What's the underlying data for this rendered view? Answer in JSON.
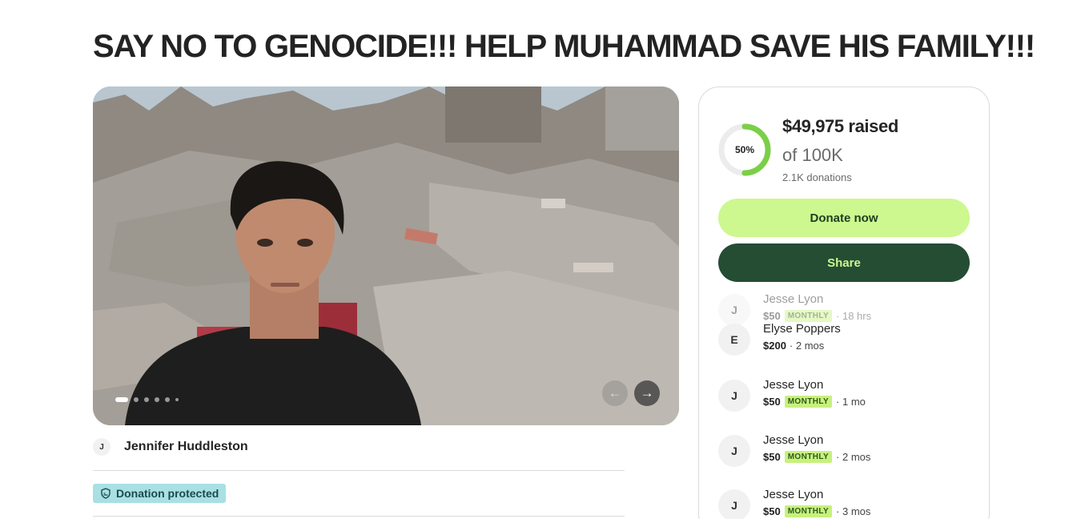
{
  "campaign": {
    "title": "SAY NO TO GENOCIDE!!! HELP MUHAMMAD SAVE HIS FAMILY!!!",
    "organizer_initial": "J",
    "organizer_name": "Jennifer Huddleston",
    "protected_label": "Donation protected"
  },
  "gallery": {
    "slide_count": 6,
    "active_slide": 1,
    "prev_icon": "arrow-left-icon",
    "next_icon": "arrow-right-icon"
  },
  "progress": {
    "percent_label": "50%",
    "fraction": 0.5,
    "raised": "$49,975 raised",
    "goal": "of 100K",
    "donations_count": "2.1K donations",
    "ring_color": "#7bcf47"
  },
  "actions": {
    "donate_label": "Donate now",
    "share_label": "Share"
  },
  "donations": [
    {
      "initial": "J",
      "name": "Jesse Lyon",
      "amount": "$50",
      "badge": "MONTHLY",
      "time": "· 18 hrs"
    },
    {
      "initial": "E",
      "name": "Elyse Poppers",
      "amount": "$200",
      "badge": "",
      "time": "· 2 mos"
    },
    {
      "initial": "J",
      "name": "Jesse Lyon",
      "amount": "$50",
      "badge": "MONTHLY",
      "time": "· 1 mo"
    },
    {
      "initial": "J",
      "name": "Jesse Lyon",
      "amount": "$50",
      "badge": "MONTHLY",
      "time": "· 2 mos"
    },
    {
      "initial": "J",
      "name": "Jesse Lyon",
      "amount": "$50",
      "badge": "MONTHLY",
      "time": "· 3 mos"
    }
  ],
  "colors": {
    "donate_bg": "#cdf78f",
    "share_bg": "#244d33",
    "protected_bg": "#a8e0e3",
    "badge_bg": "#c8f07d"
  }
}
